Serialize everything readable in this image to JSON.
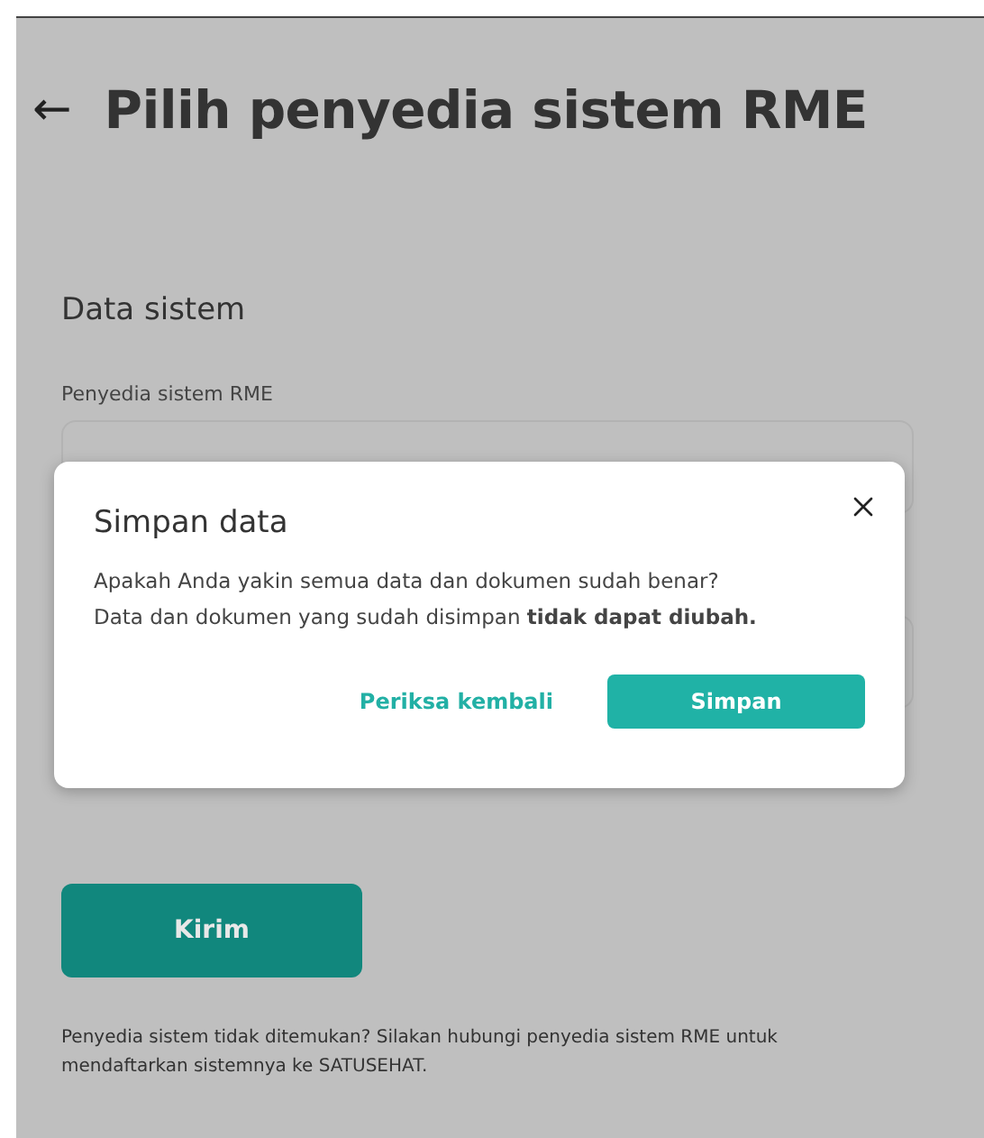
{
  "page": {
    "back": "←",
    "title": "Pilih penyedia sistem RME"
  },
  "section": {
    "title": "Data sistem",
    "field_label": "Penyedia sistem RME"
  },
  "submit": {
    "label": "Kirim"
  },
  "footnote": "Penyedia sistem tidak ditemukan? Silakan hubungi penyedia sistem RME untuk mendaftarkan sistemnya ke SATUSEHAT.",
  "dialog": {
    "title": "Simpan data",
    "message": [
      "Apakah Anda yakin semua data dan dokumen sudah benar?",
      "Data dan dokumen yang sudah disimpan **tidak dapat diubah.**"
    ],
    "secondary": "Periksa kembali",
    "primary": "Simpan"
  }
}
